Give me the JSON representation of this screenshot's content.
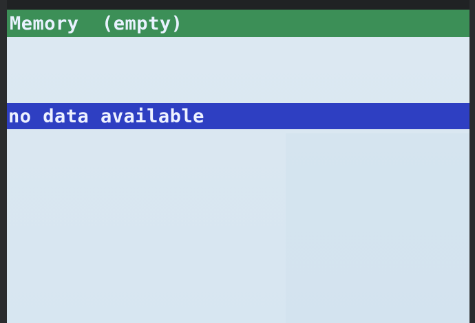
{
  "header": {
    "title": "Memory  (empty)"
  },
  "memory_list": {
    "items": [
      {
        "label": "no data available",
        "selected": true
      }
    ]
  },
  "colors": {
    "title_bar": "#3c8f57",
    "selection": "#2e3fc2",
    "screen_background": "#dae7f1",
    "text_light": "#eef2ff"
  }
}
